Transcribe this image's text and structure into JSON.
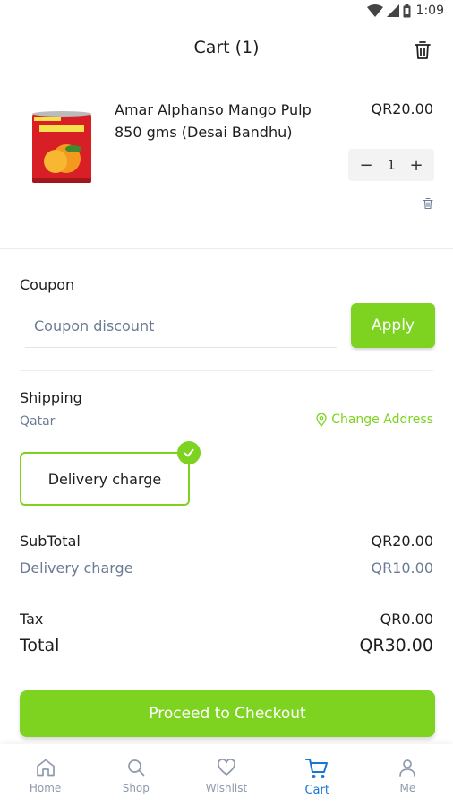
{
  "status_bar": {
    "time": "1:09"
  },
  "header": {
    "title": "Cart (1)"
  },
  "cart_item": {
    "name": "Amar Alphanso Mango Pulp 850 gms (Desai Bandhu)",
    "price": "QR20.00",
    "quantity": "1",
    "decrement": "−",
    "increment": "+"
  },
  "coupon": {
    "label": "Coupon",
    "placeholder": "Coupon discount",
    "apply_label": "Apply"
  },
  "shipping": {
    "label": "Shipping",
    "country": "Qatar",
    "change_address": "Change Address",
    "option_label": "Delivery charge"
  },
  "summary": {
    "subtotal_label": "SubTotal",
    "subtotal_value": "QR20.00",
    "delivery_label": "Delivery charge",
    "delivery_value": "QR10.00",
    "tax_label": "Tax",
    "tax_value": "QR0.00",
    "total_label": "Total",
    "total_value": "QR30.00"
  },
  "checkout": {
    "label": "Proceed to Checkout"
  },
  "bottom_nav": {
    "items": [
      {
        "label": "Home",
        "icon": "home-icon"
      },
      {
        "label": "Shop",
        "icon": "search-icon"
      },
      {
        "label": "Wishlist",
        "icon": "heart-icon"
      },
      {
        "label": "Cart",
        "icon": "cart-icon",
        "active": true
      },
      {
        "label": "Me",
        "icon": "person-icon"
      }
    ]
  },
  "colors": {
    "accent": "#7ed321",
    "active_nav": "#1976d2",
    "muted_text": "#6b7b94",
    "text": "#1d1d1d"
  }
}
